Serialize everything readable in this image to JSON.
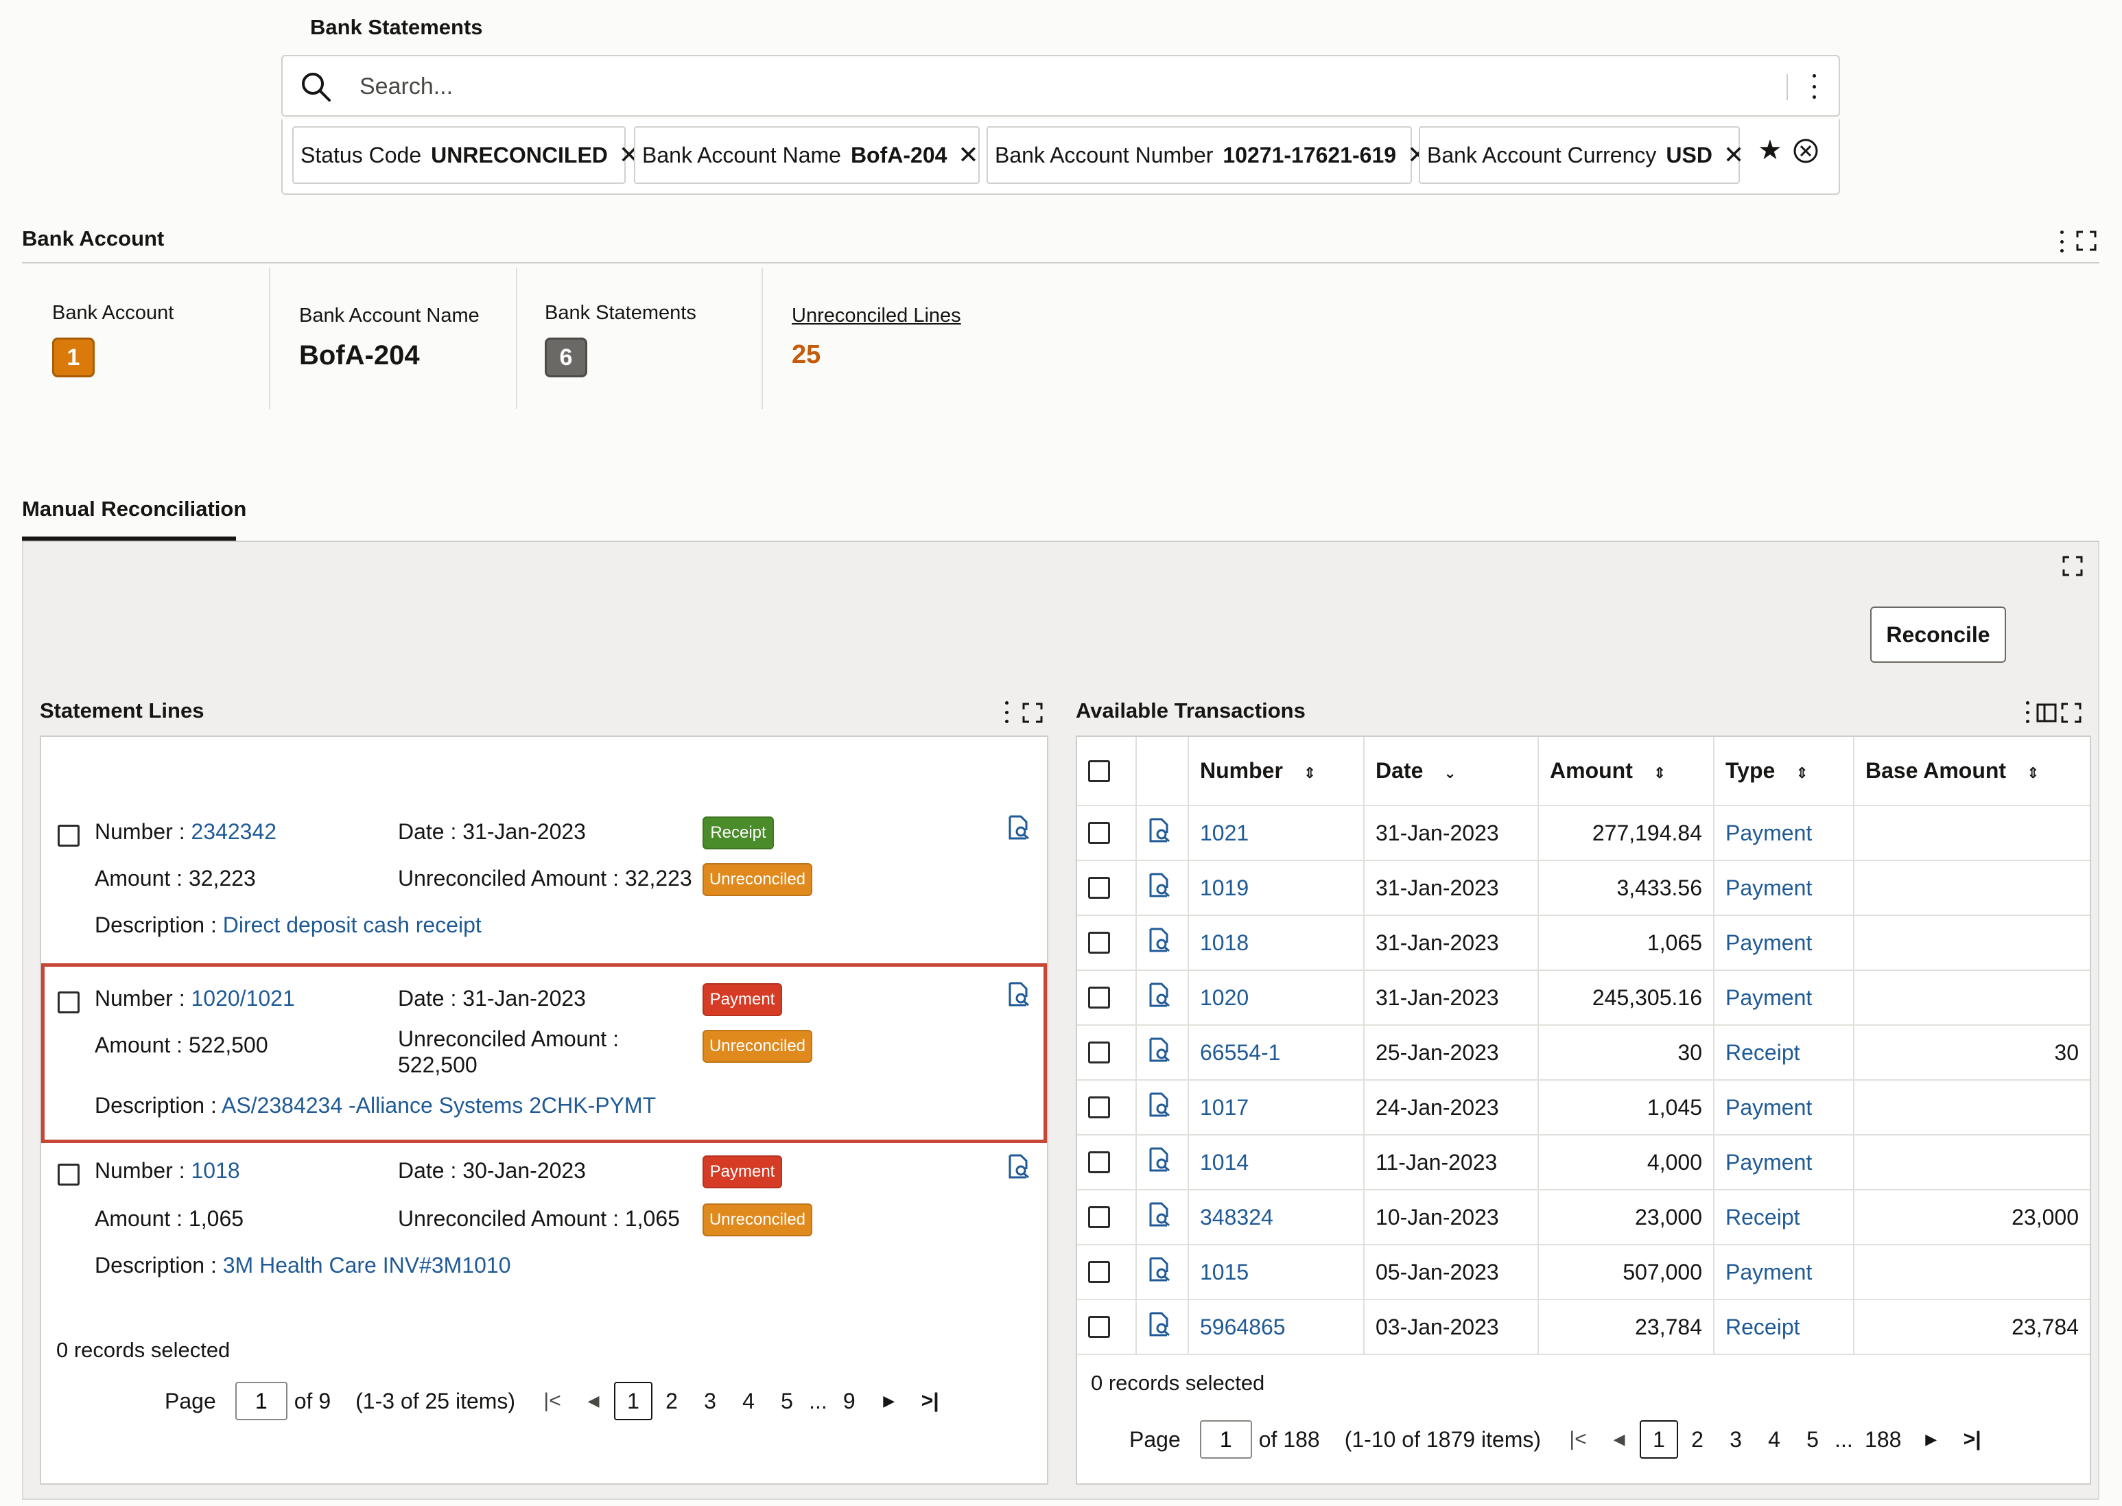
{
  "page_title": "Bank Statements",
  "search": {
    "placeholder": "Search..."
  },
  "filters": [
    {
      "label": "Status Code",
      "value": "UNRECONCILED"
    },
    {
      "label": "Bank Account Name",
      "value": "BofA-204"
    },
    {
      "label": "Bank Account Number",
      "value": "10271-17621-619"
    },
    {
      "label": "Bank Account Currency",
      "value": "USD"
    }
  ],
  "bank_account": {
    "title": "Bank Account",
    "metrics": {
      "account_label": "Bank Account",
      "account_value": "1",
      "name_label": "Bank Account Name",
      "name_value": "BofA-204",
      "statements_label": "Bank Statements",
      "statements_value": "6",
      "unreconciled_label": "Unreconciled Lines",
      "unreconciled_value": "25"
    }
  },
  "tab": {
    "label": "Manual Reconciliation"
  },
  "reconcile_label": "Reconcile",
  "statement_lines": {
    "title": "Statement Lines",
    "items": [
      {
        "number_label": "Number :",
        "number": "2342342",
        "date_label": "Date :",
        "date": "31-Jan-2023",
        "amount_label": "Amount :",
        "amount": "32,223",
        "unrec_label": "Unreconciled Amount :",
        "unrec": "32,223",
        "desc_label": "Description :",
        "desc": "Direct deposit cash receipt",
        "type": "Receipt",
        "status": "Unreconciled"
      },
      {
        "number_label": "Number :",
        "number": "1020/1021",
        "date_label": "Date :",
        "date": "31-Jan-2023",
        "amount_label": "Amount :",
        "amount": "522,500",
        "unrec_label": "Unreconciled Amount :",
        "unrec": "522,500",
        "desc_label": "Description :",
        "desc": "AS/2384234 -Alliance Systems 2CHK-PYMT",
        "type": "Payment",
        "status": "Unreconciled"
      },
      {
        "number_label": "Number :",
        "number": "1018",
        "date_label": "Date :",
        "date": "30-Jan-2023",
        "amount_label": "Amount :",
        "amount": "1,065",
        "unrec_label": "Unreconciled Amount :",
        "unrec": "1,065",
        "desc_label": "Description :",
        "desc": "3M Health Care INV#3M1010",
        "type": "Payment",
        "status": "Unreconciled"
      }
    ],
    "records_selected": "0 records selected",
    "pager": {
      "page_label": "Page",
      "page_value": "1",
      "of": "of 9",
      "range": "(1-3 of 25 items)",
      "pages": [
        "1",
        "2",
        "3",
        "4",
        "5"
      ],
      "ellipsis": "...",
      "last_page": "9"
    }
  },
  "transactions": {
    "title": "Available Transactions",
    "columns": {
      "number": "Number",
      "date": "Date",
      "amount": "Amount",
      "type": "Type",
      "base": "Base Amount"
    },
    "rows": [
      {
        "number": "1021",
        "date": "31-Jan-2023",
        "amount": "277,194.84",
        "type": "Payment",
        "base": ""
      },
      {
        "number": "1019",
        "date": "31-Jan-2023",
        "amount": "3,433.56",
        "type": "Payment",
        "base": ""
      },
      {
        "number": "1018",
        "date": "31-Jan-2023",
        "amount": "1,065",
        "type": "Payment",
        "base": ""
      },
      {
        "number": "1020",
        "date": "31-Jan-2023",
        "amount": "245,305.16",
        "type": "Payment",
        "base": ""
      },
      {
        "number": "66554-1",
        "date": "25-Jan-2023",
        "amount": "30",
        "type": "Receipt",
        "base": "30"
      },
      {
        "number": "1017",
        "date": "24-Jan-2023",
        "amount": "1,045",
        "type": "Payment",
        "base": ""
      },
      {
        "number": "1014",
        "date": "11-Jan-2023",
        "amount": "4,000",
        "type": "Payment",
        "base": ""
      },
      {
        "number": "348324",
        "date": "10-Jan-2023",
        "amount": "23,000",
        "type": "Receipt",
        "base": "23,000"
      },
      {
        "number": "1015",
        "date": "05-Jan-2023",
        "amount": "507,000",
        "type": "Payment",
        "base": ""
      },
      {
        "number": "5964865",
        "date": "03-Jan-2023",
        "amount": "23,784",
        "type": "Receipt",
        "base": "23,784"
      }
    ],
    "records_selected": "0 records selected",
    "pager": {
      "page_label": "Page",
      "page_value": "1",
      "of": "of 188",
      "range": "(1-10 of 1879 items)",
      "pages": [
        "1",
        "2",
        "3",
        "4",
        "5"
      ],
      "ellipsis": "...",
      "last_page": "188"
    }
  },
  "colors": {
    "receipt": "#4a8b2a",
    "payment": "#d63b25",
    "unreconciled": "#e08a1e",
    "link": "#1f5a96",
    "highlight": "#c74634",
    "metric_orange": "#c45a0a",
    "badge_gray": "#6b6966"
  }
}
